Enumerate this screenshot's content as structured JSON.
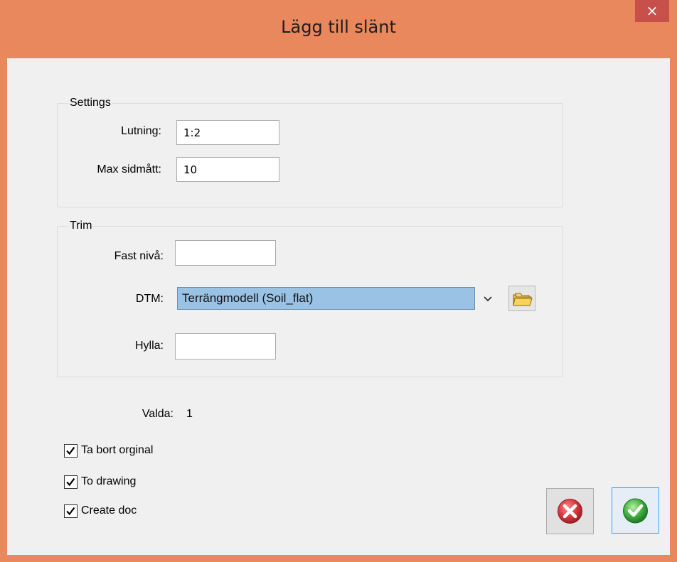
{
  "window": {
    "title": "Lägg till slänt",
    "close_glyph": "×"
  },
  "settings": {
    "legend": "Settings",
    "lutning_label": "Lutning:",
    "lutning_value": "1:2",
    "max_label": "Max sidmått:",
    "max_value": "10"
  },
  "trim": {
    "legend": "Trim",
    "fast_label": "Fast nivå:",
    "fast_value": "",
    "dtm_label": "DTM:",
    "dtm_value": "Terrängmodell (Soil_flat)",
    "hylla_label": "Hylla:",
    "hylla_value": ""
  },
  "valda": {
    "label": "Valda:",
    "value": "1"
  },
  "options": [
    {
      "label": "Ta bort orginal",
      "checked": true
    },
    {
      "label": "To drawing",
      "checked": true
    },
    {
      "label": "Create doc",
      "checked": true
    }
  ],
  "icons": {
    "close": "close-icon",
    "dropdown": "chevron-down-icon",
    "folder": "folder-icon",
    "cancel": "cancel-icon",
    "ok": "ok-icon",
    "check": "checkmark-icon"
  },
  "colors": {
    "title_bar": "#e9875d",
    "close_button": "#c7504b",
    "selection": "#99c2e4",
    "cancel_red": "#d9363e",
    "ok_green": "#3fae3f"
  }
}
